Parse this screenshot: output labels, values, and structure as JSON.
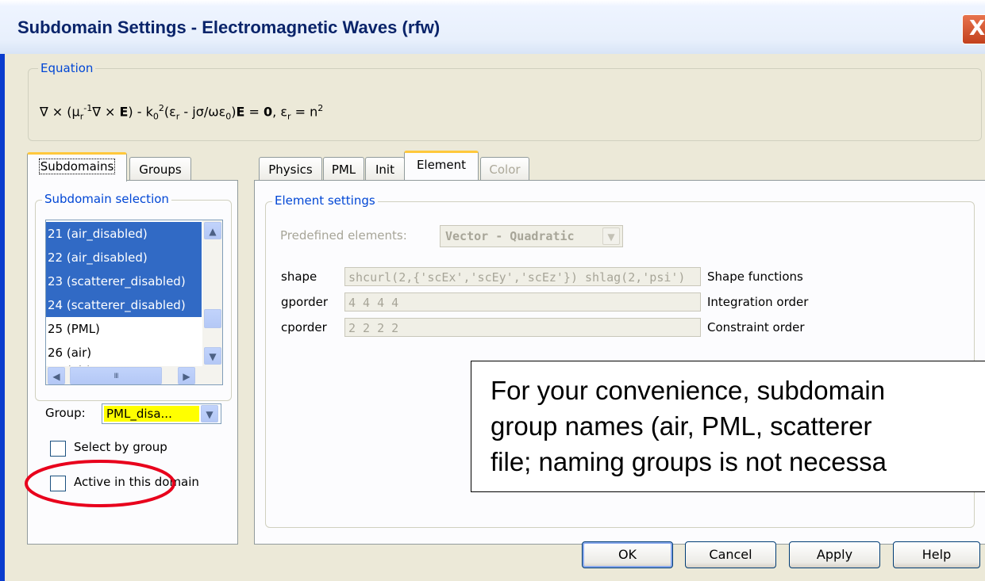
{
  "window": {
    "title": "Subdomain Settings - Electromagnetic Waves (rfw)",
    "close_glyph": "X"
  },
  "equation": {
    "legend": "Equation",
    "parts": {
      "p1": "∇ × (μ",
      "s1": "r",
      "e1": "-1",
      "p2": "∇ × ",
      "E1": "E",
      "p3": ") - k",
      "s2": "0",
      "e2": "2",
      "p4": "(ε",
      "s3": "r",
      "p5": " - jσ/ωε",
      "s4": "0",
      "p6": ")",
      "E2": "E",
      "p7": " = ",
      "zero": "0",
      "p8": ", ε",
      "s5": "r",
      "p9": " = n",
      "e3": "2"
    }
  },
  "left_tabs": {
    "subdomains": "Subdomains",
    "groups": "Groups"
  },
  "subdomain_selection": {
    "legend": "Subdomain selection",
    "items": [
      {
        "label": "21 (air_disabled)",
        "selected": true
      },
      {
        "label": "22 (air_disabled)",
        "selected": true
      },
      {
        "label": "23 (scatterer_disabled)",
        "selected": true
      },
      {
        "label": "24 (scatterer_disabled)",
        "selected": true
      },
      {
        "label": "25 (PML)",
        "selected": false
      },
      {
        "label": "26 (air)",
        "selected": false
      },
      {
        "label": "27 (air)",
        "selected": false
      }
    ],
    "scroll_up": "▲",
    "scroll_down": "▼",
    "scroll_left": "◀",
    "scroll_right": "▶",
    "hscroll_grip": "III"
  },
  "group": {
    "label": "Group:",
    "value": "PML_disa...",
    "dropdown_glyph": "▼",
    "highlight_color": "#ffff00"
  },
  "select_by_group": {
    "label": "Select by group",
    "checked": false
  },
  "active_in_domain": {
    "label": "Active in this domain",
    "checked": false,
    "annotation_color": "#e8001c"
  },
  "right_tabs": {
    "physics": "Physics",
    "pml": "PML",
    "init": "Init",
    "element": "Element",
    "color": "Color"
  },
  "element_settings": {
    "legend": "Element settings",
    "predefined_label": "Predefined elements:",
    "predefined_value": "Vector - Quadratic",
    "dropdown_glyph": "▼",
    "rows": [
      {
        "name": "shape",
        "value": "shcurl(2,{'scEx','scEy','scEz'}) shlag(2,'psi')",
        "desc": "Shape functions"
      },
      {
        "name": "gporder",
        "value": "4 4 4 4",
        "desc": "Integration order"
      },
      {
        "name": "cporder",
        "value": "2 2 2 2",
        "desc": "Constraint order"
      }
    ]
  },
  "note": {
    "lines": [
      "For your convenience, subdomain",
      "group names (air, PML, scatterer",
      "file; naming groups is not necessa"
    ]
  },
  "buttons": {
    "ok": "OK",
    "cancel": "Cancel",
    "apply": "Apply",
    "help": "Help"
  }
}
